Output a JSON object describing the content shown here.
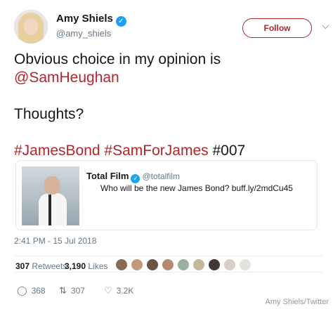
{
  "author": {
    "name": "Amy Shiels",
    "handle": "@amy_shiels",
    "verified_icon": "verified-icon"
  },
  "follow_label": "Follow",
  "tweet": {
    "line1": "Obvious choice in my opinion is",
    "mention": "@SamHeughan",
    "line3": "Thoughts?",
    "hashtag1": "#JamesBond",
    "hashtag2": "#SamForJames",
    "hashtag3": "#007"
  },
  "quoted": {
    "name": "Total Film",
    "handle": "@totalfilm",
    "text": "Who will be the new James Bond? buff.ly/2mdCu45"
  },
  "timestamp": "2:41 PM - 15 Jul 2018",
  "stats": {
    "retweets_count": "307",
    "retweets_label": "Retweets",
    "likes_count": "3,190",
    "likes_label": "Likes"
  },
  "actions": {
    "replies": "368",
    "retweets": "307",
    "likes": "3.2K"
  },
  "credit": "Amy Shiels/Twitter",
  "colors": {
    "accent": "#b0262b",
    "muted": "#657786",
    "verified": "#1da1f2"
  }
}
